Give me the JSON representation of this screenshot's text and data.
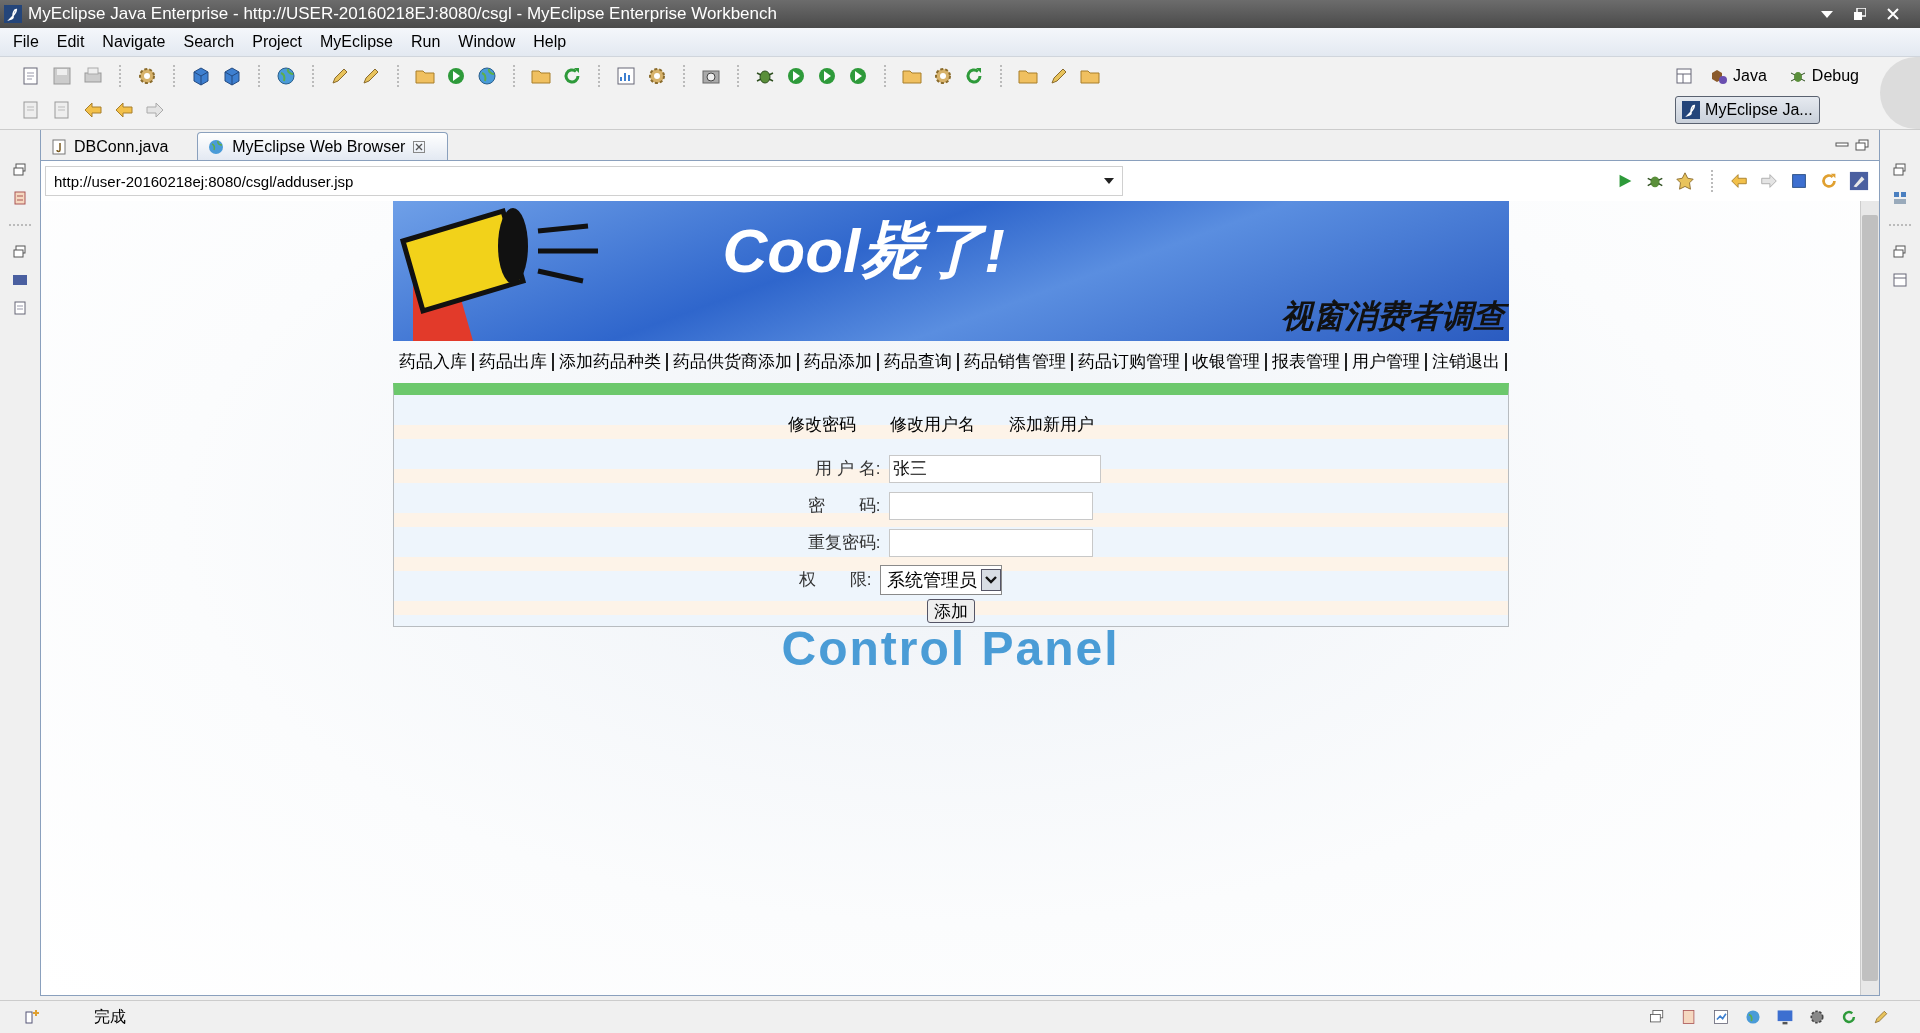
{
  "window": {
    "title": "MyEclipse Java Enterprise - http://USER-20160218EJ:8080/csgl - MyEclipse Enterprise Workbench"
  },
  "menu": [
    "File",
    "Edit",
    "Navigate",
    "Search",
    "Project",
    "MyEclipse",
    "Run",
    "Window",
    "Help"
  ],
  "perspectives": [
    {
      "label": "Java",
      "selected": false
    },
    {
      "label": "Debug",
      "selected": false
    },
    {
      "label": "MyEclipse Ja...",
      "selected": true
    }
  ],
  "editor_tabs": [
    {
      "label": "DBConn.java",
      "selected": false
    },
    {
      "label": "MyEclipse Web Browser",
      "selected": true
    }
  ],
  "browser": {
    "url": "http://user-20160218ej:8080/csgl/adduser.jsp"
  },
  "page": {
    "banner": {
      "headline": "Cool毙了!",
      "caption": "视窗消费者调查"
    },
    "nav": [
      "药品入库",
      "药品出库",
      "添加药品种类",
      "药品供货商添加",
      "药品添加",
      "药品查询",
      "药品销售管理",
      "药品订购管理",
      "收银管理",
      "报表管理",
      "用户管理",
      "注销退出"
    ],
    "subnav": [
      "修改密码",
      "修改用户名",
      "添加新用户"
    ],
    "form": {
      "fields": [
        {
          "label": "用 户 名:",
          "kind": "text",
          "value": "张三"
        },
        {
          "label": "密　　码:",
          "kind": "password"
        },
        {
          "label": "重复密码:",
          "kind": "password"
        },
        {
          "label": "权　　限:",
          "kind": "select",
          "value": "系统管理员"
        }
      ],
      "submit": "添加"
    },
    "background_text": "Control Panel"
  },
  "status_bar": {
    "message": "完成"
  }
}
